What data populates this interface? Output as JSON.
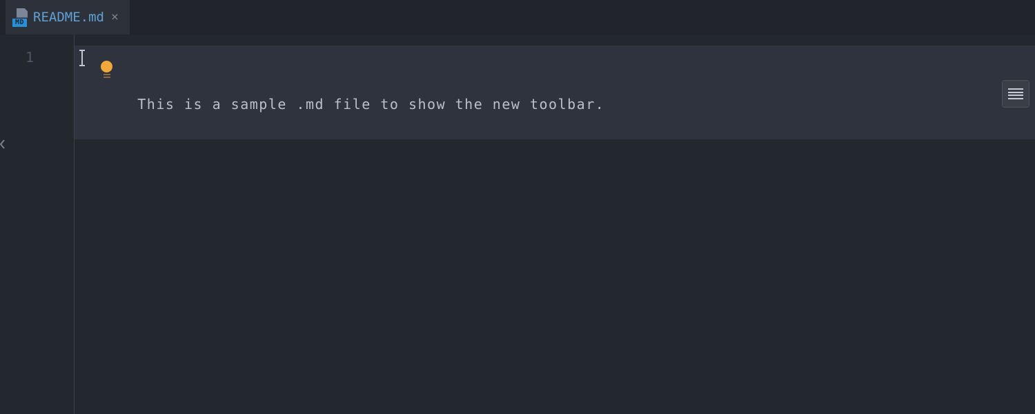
{
  "tab": {
    "filename": "README.md",
    "icon_badge": "MD"
  },
  "editor": {
    "line_numbers": [
      "1"
    ],
    "lines": [
      "This is a sample .md file to show the new toolbar."
    ]
  },
  "icons": {
    "file": "markdown-file-icon",
    "close": "close-icon",
    "bulb": "lightbulb-icon",
    "menu": "menu-icon",
    "edge": "panel-edge-icon"
  }
}
